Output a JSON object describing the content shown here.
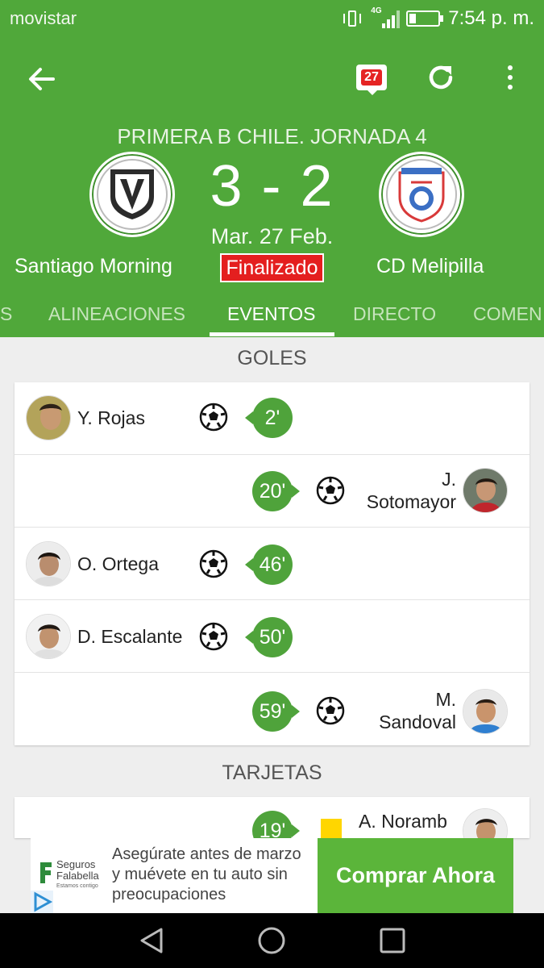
{
  "statusbar": {
    "carrier": "movistar",
    "network": "4G",
    "time": "7:54 p. m."
  },
  "appbar": {
    "calendar_day": "27"
  },
  "match": {
    "competition": "PRIMERA B CHILE. JORNADA 4",
    "score": "3 - 2",
    "date": "Mar. 27 Feb.",
    "status": "Finalizado",
    "home_team": "Santiago Morning",
    "away_team": "CD Melipilla",
    "colors": {
      "header": "#50a83a",
      "status_badge": "#e41f1f"
    }
  },
  "tabs": [
    {
      "label": "S"
    },
    {
      "label": "ALINEACIONES"
    },
    {
      "label": "EVENTOS"
    },
    {
      "label": "DIRECTO"
    },
    {
      "label": "COMEN"
    }
  ],
  "goals": {
    "title": "GOLES",
    "events": [
      {
        "player": "Y. Rojas",
        "minute": "2'",
        "side": "home"
      },
      {
        "player_line1": "J.",
        "player_line2": "Sotomayor",
        "minute": "20'",
        "side": "away"
      },
      {
        "player": "O. Ortega",
        "minute": "46'",
        "side": "home"
      },
      {
        "player": "D. Escalante",
        "minute": "50'",
        "side": "home"
      },
      {
        "player_line1": "M.",
        "player_line2": "Sandoval",
        "minute": "59'",
        "side": "away"
      }
    ]
  },
  "cards": {
    "title": "TARJETAS",
    "events": [
      {
        "player": "A. Noramb",
        "minute": "19'",
        "side": "away",
        "card": "yellow"
      }
    ]
  },
  "ad": {
    "brand_line1": "Seguros",
    "brand_line2": "Falabella",
    "brand_tagline": "Estamos contigo",
    "text": "Asegúrate antes de marzo y muévete en tu auto sin preocupaciones",
    "button": "Comprar Ahora"
  }
}
